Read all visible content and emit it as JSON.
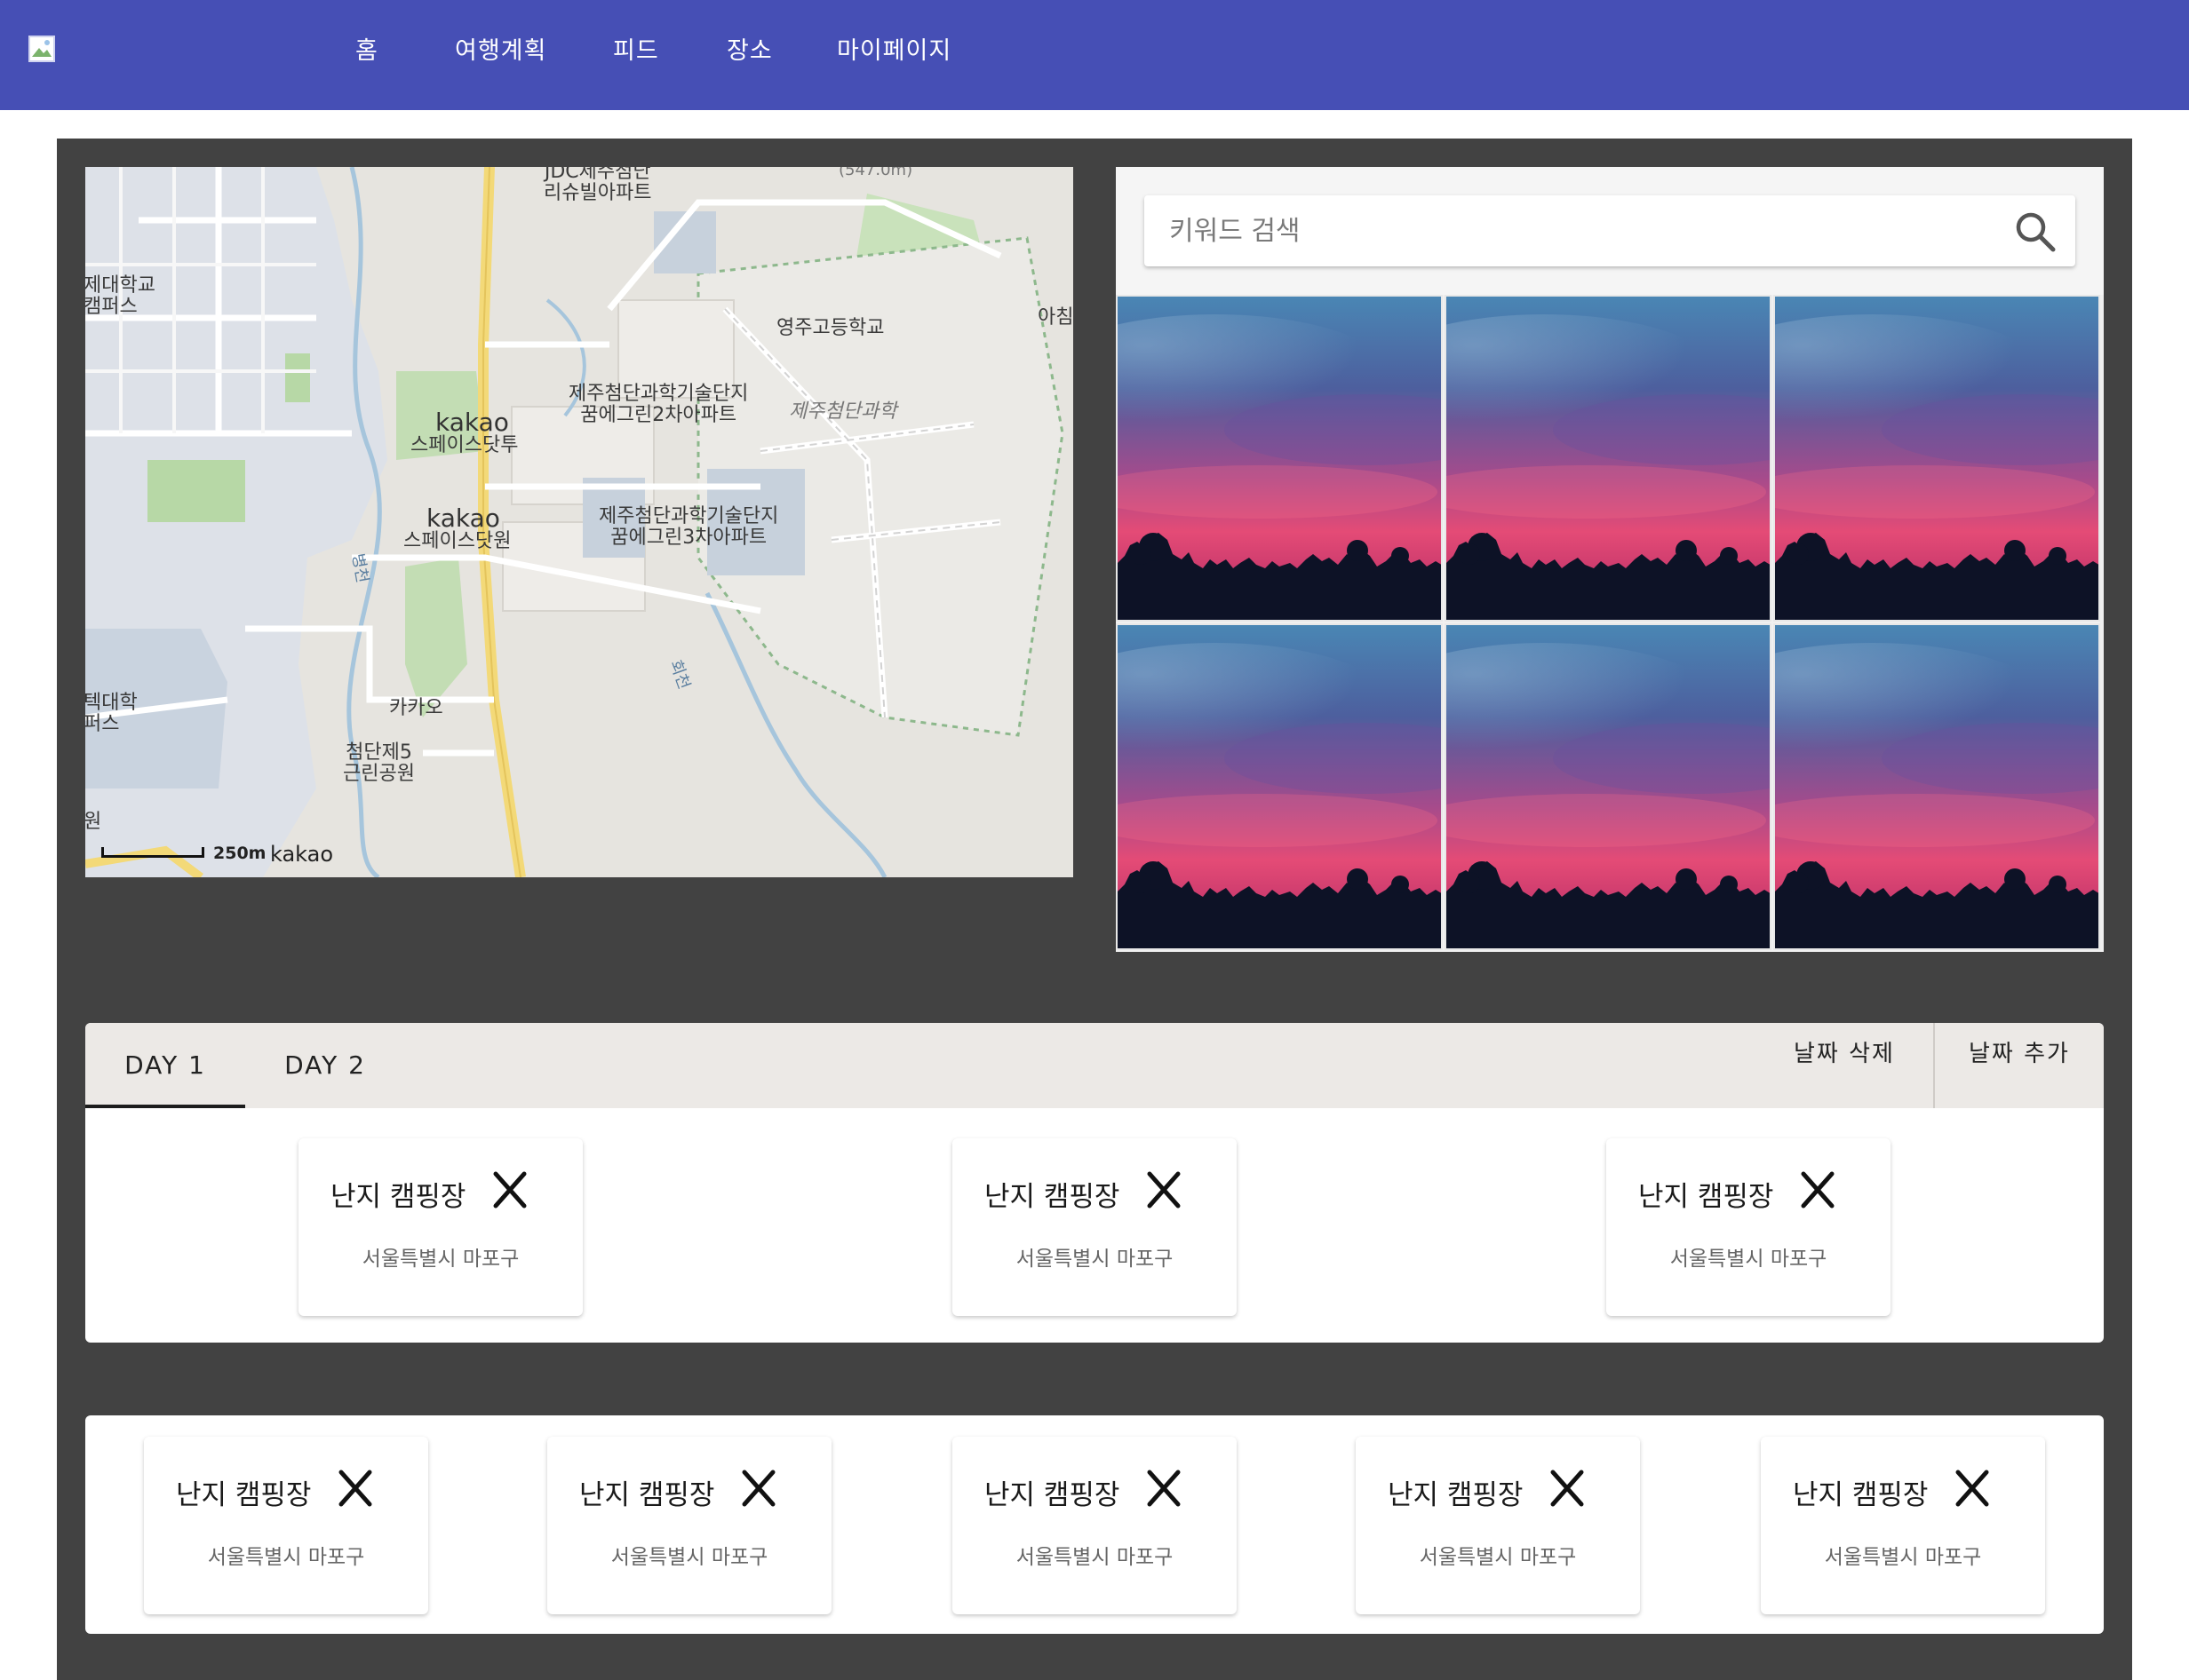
{
  "nav": {
    "logo_alt": "logo",
    "items": [
      "홈",
      "여행계획",
      "피드",
      "장소",
      "마이페이지"
    ]
  },
  "map": {
    "labels": {
      "jdc": "JDC제주첨단\n리슈빌아파트",
      "univ1": "제대학교\n캠퍼스",
      "youngju": "영주고등학교",
      "achim": "아침",
      "apt2": "제주첨단과학기술단지\n꿈에그린2차아파트",
      "sci": "제주첨단과학",
      "kakao1_a": "kakao",
      "kakao1_b": "스페이스닷투",
      "kakao2_a": "kakao",
      "kakao2_b": "스페이스닷원",
      "apt3": "제주첨단과학기술단지\n꿈에그린3차아파트",
      "kakao_park": "카카오",
      "park": "첨단제5\n근린공원",
      "univ2": "텍대학\n퍼스",
      "won": "원",
      "stream1": "병천",
      "stream2": "회천",
      "elev": "(547.0m)"
    },
    "scale": "250m",
    "brand": "kakao"
  },
  "search": {
    "placeholder": "키워드 검색",
    "value": ""
  },
  "gallery": {
    "count": 6
  },
  "schedule": {
    "tabs": [
      "DAY 1",
      "DAY 2"
    ],
    "active_tab": "DAY 1",
    "delete_day": "날짜 삭제",
    "add_day": "날짜 추가",
    "places": [
      {
        "name": "난지 캠핑장",
        "address": "서울특별시 마포구"
      },
      {
        "name": "난지 캠핑장",
        "address": "서울특별시 마포구"
      },
      {
        "name": "난지 캠핑장",
        "address": "서울특별시 마포구"
      }
    ]
  },
  "pool": {
    "places": [
      {
        "name": "난지 캠핑장",
        "address": "서울특별시 마포구"
      },
      {
        "name": "난지 캠핑장",
        "address": "서울특별시 마포구"
      },
      {
        "name": "난지 캠핑장",
        "address": "서울특별시 마포구"
      },
      {
        "name": "난지 캠핑장",
        "address": "서울특별시 마포구"
      },
      {
        "name": "난지 캠핑장",
        "address": "서울특별시 마포구"
      }
    ]
  }
}
